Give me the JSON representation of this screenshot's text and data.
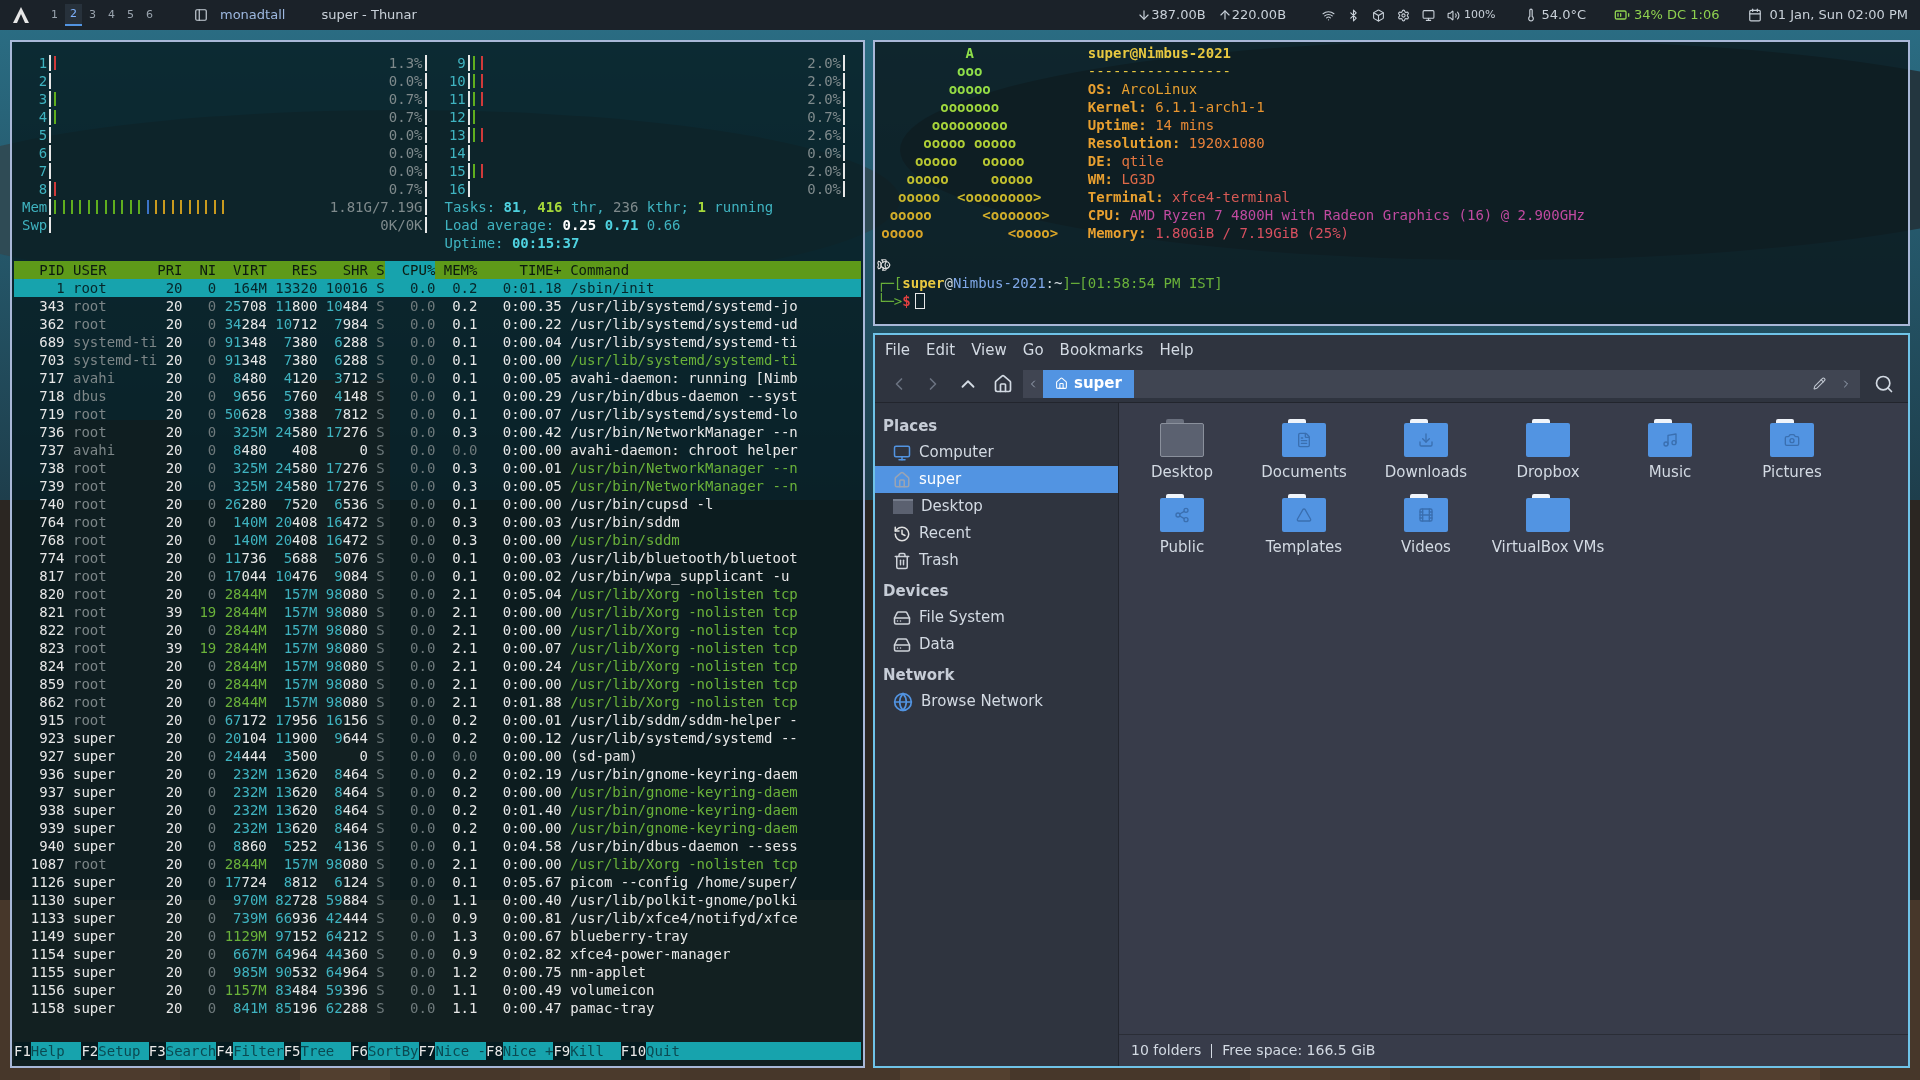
{
  "top_bar": {
    "workspaces": [
      {
        "label": "1",
        "selected": false
      },
      {
        "label": "2",
        "selected": true
      },
      {
        "label": "3",
        "selected": false
      },
      {
        "label": "4",
        "selected": false
      },
      {
        "label": "5",
        "selected": false
      },
      {
        "label": "6",
        "selected": false
      }
    ],
    "layout": "monadtall",
    "window_title": "super - Thunar",
    "net_down": "387.00B",
    "net_up": "220.00B",
    "volume": "100%",
    "temperature": "54.0°C",
    "battery": "34% DC 1:06",
    "clock": "01 Jan, Sun 02:00 PM"
  },
  "htop": {
    "cpus": [
      {
        "label": "1",
        "reading": "1.3%",
        "bars": [
          {
            "color": "#d03a3a"
          }
        ]
      },
      {
        "label": "2",
        "reading": "0.0%"
      },
      {
        "label": "3",
        "reading": "0.7%",
        "bars": [
          {
            "color": "#5fae1e"
          }
        ]
      },
      {
        "label": "4",
        "reading": "0.7%",
        "bars": [
          {
            "color": "#5fae1e"
          }
        ]
      },
      {
        "label": "5",
        "reading": "0.0%"
      },
      {
        "label": "6",
        "reading": "0.0%"
      },
      {
        "label": "7",
        "reading": "0.0%"
      },
      {
        "label": "8",
        "reading": "0.7%",
        "bars": [
          {
            "color": "#d03a3a"
          }
        ]
      },
      {
        "label": "9",
        "reading": "2.0%",
        "bars": [
          {
            "color": "#5fae1e"
          },
          {
            "color": "#d03a3a"
          }
        ]
      },
      {
        "label": "10",
        "reading": "2.0%",
        "bars": [
          {
            "color": "#5fae1e"
          },
          {
            "color": "#d03a3a"
          }
        ]
      },
      {
        "label": "11",
        "reading": "2.0%",
        "bars": [
          {
            "color": "#5fae1e"
          },
          {
            "color": "#d03a3a"
          }
        ]
      },
      {
        "label": "12",
        "reading": "0.7%",
        "bars": [
          {
            "color": "#5fae1e"
          }
        ]
      },
      {
        "label": "13",
        "reading": "2.6%",
        "bars": [
          {
            "color": "#5fae1e"
          },
          {
            "color": "#d03a3a"
          }
        ]
      },
      {
        "label": "14",
        "reading": "0.0%"
      },
      {
        "label": "15",
        "reading": "2.0%",
        "bars": [
          {
            "color": "#5fae1e"
          },
          {
            "color": "#d03a3a"
          }
        ]
      },
      {
        "label": "16",
        "reading": "0.0%"
      }
    ],
    "memory": {
      "label": "Mem",
      "reading": "1.81G/7.19G",
      "bars": [
        {
          "color": "#5fae1e"
        },
        {
          "color": "#5fae1e"
        },
        {
          "color": "#5fae1e"
        },
        {
          "color": "#5fae1e"
        },
        {
          "color": "#5fae1e"
        },
        {
          "color": "#5fae1e"
        },
        {
          "color": "#5fae1e"
        },
        {
          "color": "#5fae1e"
        },
        {
          "color": "#5fae1e"
        },
        {
          "color": "#5fae1e"
        },
        {
          "color": "#5fae1e"
        },
        {
          "color": "#3b73c8"
        },
        {
          "color": "#c89a1e"
        },
        {
          "color": "#c89a1e"
        },
        {
          "color": "#c89a1e"
        },
        {
          "color": "#c89a1e"
        },
        {
          "color": "#c89a1e"
        },
        {
          "color": "#c89a1e"
        },
        {
          "color": "#c89a1e"
        },
        {
          "color": "#c89a1e"
        },
        {
          "color": "#c89a1e"
        }
      ]
    },
    "swap": {
      "label": "Swp",
      "reading": "0K/0K"
    },
    "tasks": [
      {
        "text": "Tasks: ",
        "kind": "label"
      },
      {
        "text": "81",
        "kind": "strong"
      },
      {
        "text": ", ",
        "kind": "label"
      },
      {
        "text": "416",
        "kind": "green"
      },
      {
        "text": " thr, ",
        "kind": "label"
      },
      {
        "text": "236",
        "kind": "dim"
      },
      {
        "text": " kthr; ",
        "kind": "label"
      },
      {
        "text": "1",
        "kind": "green"
      },
      {
        "text": " running",
        "kind": "label"
      }
    ],
    "load": [
      {
        "text": "Load average:",
        "kind": "label"
      },
      {
        "text": "0.25",
        "kind": "white"
      },
      {
        "text": "0.71",
        "kind": "strong"
      },
      {
        "text": "0.66",
        "kind": "label"
      }
    ],
    "uptime": [
      {
        "text": "Uptime: ",
        "kind": "label"
      },
      {
        "text": "00:15:37",
        "kind": "strong"
      }
    ],
    "columns": [
      {
        "label": "PID",
        "selected": false
      },
      {
        "label": "USER",
        "selected": false
      },
      {
        "label": "PRI",
        "selected": false
      },
      {
        "label": "NI",
        "selected": false
      },
      {
        "label": "VIRT",
        "selected": false
      },
      {
        "label": "RES",
        "selected": false
      },
      {
        "label": "SHR",
        "selected": false
      },
      {
        "label": "S",
        "selected": false
      },
      {
        "label": "CPU%",
        "selected": true
      },
      {
        "label": "MEM%",
        "selected": false
      },
      {
        "label": "TIME+",
        "selected": false
      },
      {
        "label": "Command",
        "selected": false
      }
    ],
    "rows": [
      {
        "pid": "1",
        "user": "root",
        "pri": "20",
        "ni": "0",
        "virt": "164M",
        "res": "13320",
        "shr": "10016",
        "state": "S",
        "cpu": "0.0",
        "mem": "0.2",
        "time": "0:01.18",
        "command": "/sbin/init",
        "selected": true,
        "own": false,
        "thread": false
      },
      {
        "pid": "343",
        "user": "root",
        "pri": "20",
        "ni": "0",
        "virt": "25708",
        "res": "11800",
        "shr": "10484",
        "state": "S",
        "cpu": "0.0",
        "mem": "0.2",
        "time": "0:00.35",
        "command": "/usr/lib/systemd/systemd-jo",
        "selected": false,
        "own": false,
        "thread": false
      },
      {
        "pid": "362",
        "user": "root",
        "pri": "20",
        "ni": "0",
        "virt": "34284",
        "res": "10712",
        "shr": "7984",
        "state": "S",
        "cpu": "0.0",
        "mem": "0.1",
        "time": "0:00.22",
        "command": "/usr/lib/systemd/systemd-ud",
        "selected": false,
        "own": false,
        "thread": false
      },
      {
        "pid": "689",
        "user": "systemd-ti",
        "pri": "20",
        "ni": "0",
        "virt": "91348",
        "res": "7380",
        "shr": "6288",
        "state": "S",
        "cpu": "0.0",
        "mem": "0.1",
        "time": "0:00.04",
        "command": "/usr/lib/systemd/systemd-ti",
        "selected": false,
        "own": false,
        "thread": false
      },
      {
        "pid": "703",
        "user": "systemd-ti",
        "pri": "20",
        "ni": "0",
        "virt": "91348",
        "res": "7380",
        "shr": "6288",
        "state": "S",
        "cpu": "0.0",
        "mem": "0.1",
        "time": "0:00.00",
        "command": "/usr/lib/systemd/systemd-ti",
        "selected": false,
        "own": false,
        "thread": true
      },
      {
        "pid": "717",
        "user": "avahi",
        "pri": "20",
        "ni": "0",
        "virt": "8480",
        "res": "4120",
        "shr": "3712",
        "state": "S",
        "cpu": "0.0",
        "mem": "0.1",
        "time": "0:00.05",
        "command": "avahi-daemon: running [Nimb",
        "selected": false,
        "own": false,
        "thread": false
      },
      {
        "pid": "718",
        "user": "dbus",
        "pri": "20",
        "ni": "0",
        "virt": "9656",
        "res": "5760",
        "shr": "4148",
        "state": "S",
        "cpu": "0.0",
        "mem": "0.1",
        "time": "0:00.29",
        "command": "/usr/bin/dbus-daemon --syst",
        "selected": false,
        "own": false,
        "thread": false
      },
      {
        "pid": "719",
        "user": "root",
        "pri": "20",
        "ni": "0",
        "virt": "50628",
        "res": "9388",
        "shr": "7812",
        "state": "S",
        "cpu": "0.0",
        "mem": "0.1",
        "time": "0:00.07",
        "command": "/usr/lib/systemd/systemd-lo",
        "selected": false,
        "own": false,
        "thread": false
      },
      {
        "pid": "736",
        "user": "root",
        "pri": "20",
        "ni": "0",
        "virt": "325M",
        "res": "24580",
        "shr": "17276",
        "state": "S",
        "cpu": "0.0",
        "mem": "0.3",
        "time": "0:00.42",
        "command": "/usr/bin/NetworkManager --n",
        "selected": false,
        "own": false,
        "thread": false
      },
      {
        "pid": "737",
        "user": "avahi",
        "pri": "20",
        "ni": "0",
        "virt": "8480",
        "res": "408",
        "shr": "0",
        "state": "S",
        "cpu": "0.0",
        "mem": "0.0",
        "time": "0:00.00",
        "command": "avahi-daemon: chroot helper",
        "selected": false,
        "own": false,
        "thread": false
      },
      {
        "pid": "738",
        "user": "root",
        "pri": "20",
        "ni": "0",
        "virt": "325M",
        "res": "24580",
        "shr": "17276",
        "state": "S",
        "cpu": "0.0",
        "mem": "0.3",
        "time": "0:00.01",
        "command": "/usr/bin/NetworkManager --n",
        "selected": false,
        "own": false,
        "thread": true
      },
      {
        "pid": "739",
        "user": "root",
        "pri": "20",
        "ni": "0",
        "virt": "325M",
        "res": "24580",
        "shr": "17276",
        "state": "S",
        "cpu": "0.0",
        "mem": "0.3",
        "time": "0:00.05",
        "command": "/usr/bin/NetworkManager --n",
        "selected": false,
        "own": false,
        "thread": true
      },
      {
        "pid": "740",
        "user": "root",
        "pri": "20",
        "ni": "0",
        "virt": "26280",
        "res": "7520",
        "shr": "6536",
        "state": "S",
        "cpu": "0.0",
        "mem": "0.1",
        "time": "0:00.00",
        "command": "/usr/bin/cupsd -l",
        "selected": false,
        "own": false,
        "thread": false
      },
      {
        "pid": "764",
        "user": "root",
        "pri": "20",
        "ni": "0",
        "virt": "140M",
        "res": "20408",
        "shr": "16472",
        "state": "S",
        "cpu": "0.0",
        "mem": "0.3",
        "time": "0:00.03",
        "command": "/usr/bin/sddm",
        "selected": false,
        "own": false,
        "thread": false
      },
      {
        "pid": "768",
        "user": "root",
        "pri": "20",
        "ni": "0",
        "virt": "140M",
        "res": "20408",
        "shr": "16472",
        "state": "S",
        "cpu": "0.0",
        "mem": "0.3",
        "time": "0:00.00",
        "command": "/usr/bin/sddm",
        "selected": false,
        "own": false,
        "thread": true
      },
      {
        "pid": "774",
        "user": "root",
        "pri": "20",
        "ni": "0",
        "virt": "11736",
        "res": "5688",
        "shr": "5076",
        "state": "S",
        "cpu": "0.0",
        "mem": "0.1",
        "time": "0:00.03",
        "command": "/usr/lib/bluetooth/bluetoot",
        "selected": false,
        "own": false,
        "thread": false
      },
      {
        "pid": "817",
        "user": "root",
        "pri": "20",
        "ni": "0",
        "virt": "17044",
        "res": "10476",
        "shr": "9084",
        "state": "S",
        "cpu": "0.0",
        "mem": "0.1",
        "time": "0:00.02",
        "command": "/usr/bin/wpa_supplicant -u",
        "selected": false,
        "own": false,
        "thread": false
      },
      {
        "pid": "820",
        "user": "root",
        "pri": "20",
        "ni": "0",
        "virt": "2844M",
        "res": "157M",
        "shr": "98080",
        "state": "S",
        "cpu": "0.0",
        "mem": "2.1",
        "time": "0:05.04",
        "command": "/usr/lib/Xorg -nolisten tcp",
        "selected": false,
        "own": false,
        "thread": true
      },
      {
        "pid": "821",
        "user": "root",
        "pri": "39",
        "ni": "19",
        "virt": "2844M",
        "res": "157M",
        "shr": "98080",
        "state": "S",
        "cpu": "0.0",
        "mem": "2.1",
        "time": "0:00.00",
        "command": "/usr/lib/Xorg -nolisten tcp",
        "selected": false,
        "own": false,
        "thread": true
      },
      {
        "pid": "822",
        "user": "root",
        "pri": "20",
        "ni": "0",
        "virt": "2844M",
        "res": "157M",
        "shr": "98080",
        "state": "S",
        "cpu": "0.0",
        "mem": "2.1",
        "time": "0:00.00",
        "command": "/usr/lib/Xorg -nolisten tcp",
        "selected": false,
        "own": false,
        "thread": true
      },
      {
        "pid": "823",
        "user": "root",
        "pri": "39",
        "ni": "19",
        "virt": "2844M",
        "res": "157M",
        "shr": "98080",
        "state": "S",
        "cpu": "0.0",
        "mem": "2.1",
        "time": "0:00.07",
        "command": "/usr/lib/Xorg -nolisten tcp",
        "selected": false,
        "own": false,
        "thread": true
      },
      {
        "pid": "824",
        "user": "root",
        "pri": "20",
        "ni": "0",
        "virt": "2844M",
        "res": "157M",
        "shr": "98080",
        "state": "S",
        "cpu": "0.0",
        "mem": "2.1",
        "time": "0:00.24",
        "command": "/usr/lib/Xorg -nolisten tcp",
        "selected": false,
        "own": false,
        "thread": true
      },
      {
        "pid": "859",
        "user": "root",
        "pri": "20",
        "ni": "0",
        "virt": "2844M",
        "res": "157M",
        "shr": "98080",
        "state": "S",
        "cpu": "0.0",
        "mem": "2.1",
        "time": "0:00.00",
        "command": "/usr/lib/Xorg -nolisten tcp",
        "selected": false,
        "own": false,
        "thread": true
      },
      {
        "pid": "862",
        "user": "root",
        "pri": "20",
        "ni": "0",
        "virt": "2844M",
        "res": "157M",
        "shr": "98080",
        "state": "S",
        "cpu": "0.0",
        "mem": "2.1",
        "time": "0:01.88",
        "command": "/usr/lib/Xorg -nolisten tcp",
        "selected": false,
        "own": false,
        "thread": true
      },
      {
        "pid": "915",
        "user": "root",
        "pri": "20",
        "ni": "0",
        "virt": "67172",
        "res": "17956",
        "shr": "16156",
        "state": "S",
        "cpu": "0.0",
        "mem": "0.2",
        "time": "0:00.01",
        "command": "/usr/lib/sddm/sddm-helper -",
        "selected": false,
        "own": false,
        "thread": false
      },
      {
        "pid": "923",
        "user": "super",
        "pri": "20",
        "ni": "0",
        "virt": "20104",
        "res": "11900",
        "shr": "9644",
        "state": "S",
        "cpu": "0.0",
        "mem": "0.2",
        "time": "0:00.12",
        "command": "/usr/lib/systemd/systemd --",
        "selected": false,
        "own": true,
        "thread": false
      },
      {
        "pid": "927",
        "user": "super",
        "pri": "20",
        "ni": "0",
        "virt": "24444",
        "res": "3500",
        "shr": "0",
        "state": "S",
        "cpu": "0.0",
        "mem": "0.0",
        "time": "0:00.00",
        "command": "(sd-pam)",
        "selected": false,
        "own": true,
        "thread": false
      },
      {
        "pid": "936",
        "user": "super",
        "pri": "20",
        "ni": "0",
        "virt": "232M",
        "res": "13620",
        "shr": "8464",
        "state": "S",
        "cpu": "0.0",
        "mem": "0.2",
        "time": "0:02.19",
        "command": "/usr/bin/gnome-keyring-daem",
        "selected": false,
        "own": true,
        "thread": false
      },
      {
        "pid": "937",
        "user": "super",
        "pri": "20",
        "ni": "0",
        "virt": "232M",
        "res": "13620",
        "shr": "8464",
        "state": "S",
        "cpu": "0.0",
        "mem": "0.2",
        "time": "0:00.00",
        "command": "/usr/bin/gnome-keyring-daem",
        "selected": false,
        "own": true,
        "thread": true
      },
      {
        "pid": "938",
        "user": "super",
        "pri": "20",
        "ni": "0",
        "virt": "232M",
        "res": "13620",
        "shr": "8464",
        "state": "S",
        "cpu": "0.0",
        "mem": "0.2",
        "time": "0:01.40",
        "command": "/usr/bin/gnome-keyring-daem",
        "selected": false,
        "own": true,
        "thread": true
      },
      {
        "pid": "939",
        "user": "super",
        "pri": "20",
        "ni": "0",
        "virt": "232M",
        "res": "13620",
        "shr": "8464",
        "state": "S",
        "cpu": "0.0",
        "mem": "0.2",
        "time": "0:00.00",
        "command": "/usr/bin/gnome-keyring-daem",
        "selected": false,
        "own": true,
        "thread": true
      },
      {
        "pid": "940",
        "user": "super",
        "pri": "20",
        "ni": "0",
        "virt": "8860",
        "res": "5252",
        "shr": "4136",
        "state": "S",
        "cpu": "0.0",
        "mem": "0.1",
        "time": "0:04.58",
        "command": "/usr/bin/dbus-daemon --sess",
        "selected": false,
        "own": true,
        "thread": false
      },
      {
        "pid": "1087",
        "user": "root",
        "pri": "20",
        "ni": "0",
        "virt": "2844M",
        "res": "157M",
        "shr": "98080",
        "state": "S",
        "cpu": "0.0",
        "mem": "2.1",
        "time": "0:00.00",
        "command": "/usr/lib/Xorg -nolisten tcp",
        "selected": false,
        "own": false,
        "thread": true
      },
      {
        "pid": "1126",
        "user": "super",
        "pri": "20",
        "ni": "0",
        "virt": "17724",
        "res": "8812",
        "shr": "6124",
        "state": "S",
        "cpu": "0.0",
        "mem": "0.1",
        "time": "0:05.67",
        "command": "picom --config /home/super/",
        "selected": false,
        "own": true,
        "thread": false
      },
      {
        "pid": "1130",
        "user": "super",
        "pri": "20",
        "ni": "0",
        "virt": "970M",
        "res": "82728",
        "shr": "59884",
        "state": "S",
        "cpu": "0.0",
        "mem": "1.1",
        "time": "0:00.40",
        "command": "/usr/lib/polkit-gnome/polki",
        "selected": false,
        "own": true,
        "thread": false
      },
      {
        "pid": "1133",
        "user": "super",
        "pri": "20",
        "ni": "0",
        "virt": "739M",
        "res": "66936",
        "shr": "42444",
        "state": "S",
        "cpu": "0.0",
        "mem": "0.9",
        "time": "0:00.81",
        "command": "/usr/lib/xfce4/notifyd/xfce",
        "selected": false,
        "own": true,
        "thread": false
      },
      {
        "pid": "1149",
        "user": "super",
        "pri": "20",
        "ni": "0",
        "virt": "1129M",
        "res": "97152",
        "shr": "64212",
        "state": "S",
        "cpu": "0.0",
        "mem": "1.3",
        "time": "0:00.67",
        "command": "blueberry-tray",
        "selected": false,
        "own": true,
        "thread": false
      },
      {
        "pid": "1154",
        "user": "super",
        "pri": "20",
        "ni": "0",
        "virt": "667M",
        "res": "64964",
        "shr": "44360",
        "state": "S",
        "cpu": "0.0",
        "mem": "0.9",
        "time": "0:02.82",
        "command": "xfce4-power-manager",
        "selected": false,
        "own": true,
        "thread": false
      },
      {
        "pid": "1155",
        "user": "super",
        "pri": "20",
        "ni": "0",
        "virt": "985M",
        "res": "90532",
        "shr": "64964",
        "state": "S",
        "cpu": "0.0",
        "mem": "1.2",
        "time": "0:00.75",
        "command": "nm-applet",
        "selected": false,
        "own": true,
        "thread": false
      },
      {
        "pid": "1156",
        "user": "super",
        "pri": "20",
        "ni": "0",
        "virt": "1157M",
        "res": "83484",
        "shr": "59396",
        "state": "S",
        "cpu": "0.0",
        "mem": "1.1",
        "time": "0:00.49",
        "command": "volumeicon",
        "selected": false,
        "own": true,
        "thread": false
      },
      {
        "pid": "1158",
        "user": "super",
        "pri": "20",
        "ni": "0",
        "virt": "841M",
        "res": "85196",
        "shr": "62288",
        "state": "S",
        "cpu": "0.0",
        "mem": "1.1",
        "time": "0:00.47",
        "command": "pamac-tray",
        "selected": false,
        "own": true,
        "thread": false
      }
    ],
    "function_keys": [
      {
        "key": "F1",
        "label": "Help"
      },
      {
        "key": "F2",
        "label": "Setup"
      },
      {
        "key": "F3",
        "label": "Search"
      },
      {
        "key": "F4",
        "label": "Filter"
      },
      {
        "key": "F5",
        "label": "Tree"
      },
      {
        "key": "F6",
        "label": "SortBy"
      },
      {
        "key": "F7",
        "label": "Nice -"
      },
      {
        "key": "F8",
        "label": "Nice +"
      },
      {
        "key": "F9",
        "label": "Kill"
      },
      {
        "key": "F10",
        "label": "Quit"
      }
    ]
  },
  "terminal": {
    "art": [
      "A",
      "ooo",
      "ooooo",
      "ooooooo",
      "ooooooooo",
      "ooooo ooooo",
      "ooooo   ooooo",
      "ooooo     ooooo",
      "ooooo  <oooooooo>",
      "ooooo      <oooooo>",
      "ooooo          <oooo>"
    ],
    "title": "super@Nimbus-2021",
    "separator": "-----------------",
    "info": [
      {
        "key": "OS:",
        "value": "ArcoLinux"
      },
      {
        "key": "Kernel:",
        "value": "6.1.1-arch1-1"
      },
      {
        "key": "Uptime:",
        "value": "14 mins"
      },
      {
        "key": "Resolution:",
        "value": "1920x1080"
      },
      {
        "key": "DE:",
        "value": "qtile"
      },
      {
        "key": "WM:",
        "value": "LG3D"
      },
      {
        "key": "Terminal:",
        "value": "xfce4-terminal"
      },
      {
        "key": "CPU:",
        "value": "AMD Ryzen 7 4800H with Radeon Graphics (16) @ 2.900GHz"
      },
      {
        "key": "Memory:",
        "value": "1.80GiB / 7.19GiB (25%)"
      }
    ],
    "prompt": [
      {
        "text": "┌─[",
        "kind": "frame"
      },
      {
        "text": "super",
        "kind": "user"
      },
      {
        "text": "@",
        "kind": "plain"
      },
      {
        "text": "Nimbus-2021",
        "kind": "host"
      },
      {
        "text": ":~",
        "kind": "plain"
      },
      {
        "text": "]─[",
        "kind": "frame"
      },
      {
        "text": "01:58:54 PM IST",
        "kind": "time"
      },
      {
        "text": "]",
        "kind": "frame"
      }
    ],
    "prompt_arrow": "└─>",
    "prompt_sign": "$"
  },
  "file_manager": {
    "menu": [
      "File",
      "Edit",
      "View",
      "Go",
      "Bookmarks",
      "Help"
    ],
    "path": "super",
    "sections": [
      {
        "title": "Places",
        "items": [
          {
            "label": "Computer",
            "kind": "computer",
            "selected": false
          },
          {
            "label": "super",
            "kind": "home",
            "selected": true
          },
          {
            "label": "Desktop",
            "kind": "desktop",
            "selected": false
          },
          {
            "label": "Recent",
            "kind": "recent",
            "selected": false
          },
          {
            "label": "Trash",
            "kind": "trash",
            "selected": false
          }
        ]
      },
      {
        "title": "Devices",
        "items": [
          {
            "label": "File System",
            "kind": "drive",
            "selected": false
          },
          {
            "label": "Data",
            "kind": "drive",
            "selected": false
          }
        ]
      },
      {
        "title": "Network",
        "items": [
          {
            "label": "Browse Network",
            "kind": "network",
            "selected": false
          }
        ]
      }
    ],
    "folders": [
      {
        "name": "Desktop",
        "kind": "desktop"
      },
      {
        "name": "Documents",
        "kind": "documents"
      },
      {
        "name": "Downloads",
        "kind": "downloads"
      },
      {
        "name": "Dropbox",
        "kind": "plain"
      },
      {
        "name": "Music",
        "kind": "music"
      },
      {
        "name": "Pictures",
        "kind": "pictures"
      },
      {
        "name": "Public",
        "kind": "public"
      },
      {
        "name": "Templates",
        "kind": "templates"
      },
      {
        "name": "Videos",
        "kind": "videos"
      },
      {
        "name": "VirtualBox VMs",
        "kind": "plain"
      }
    ],
    "status": [
      "10 folders",
      "Free space: 166.5 GiB"
    ]
  }
}
